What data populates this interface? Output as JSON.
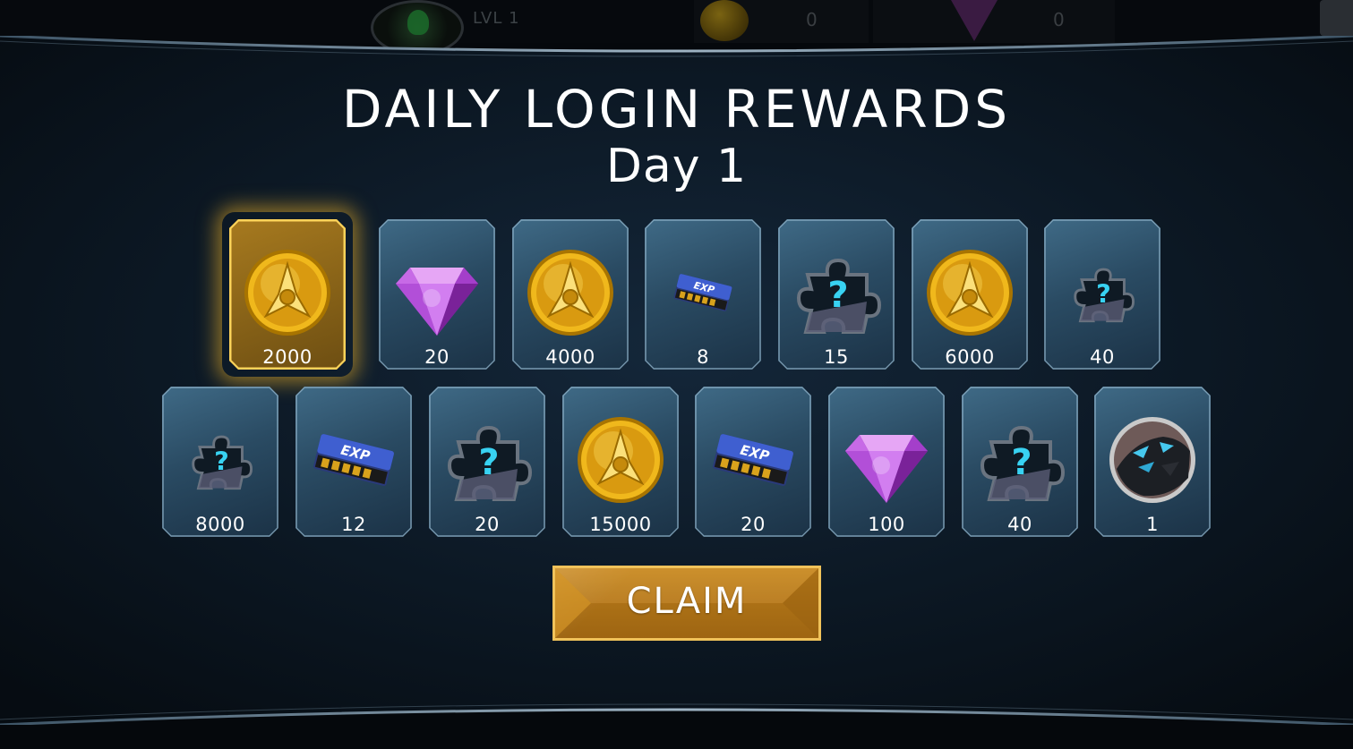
{
  "hud": {
    "level": "LVL 1",
    "coins": "0",
    "gems": "0"
  },
  "dialog": {
    "title": "DAILY LOGIN REWARDS",
    "subtitle": "Day 1",
    "claim_label": "CLAIM"
  },
  "rewards": [
    {
      "amount": "2000",
      "icon": "gold-coin-icon",
      "active": true
    },
    {
      "amount": "20",
      "icon": "purple-gem-icon",
      "active": false
    },
    {
      "amount": "4000",
      "icon": "gold-coin-icon",
      "active": false
    },
    {
      "amount": "8",
      "icon": "exp-card-icon",
      "active": false
    },
    {
      "amount": "15",
      "icon": "mystery-shard-icon",
      "active": false
    },
    {
      "amount": "6000",
      "icon": "gold-coin-icon",
      "active": false
    },
    {
      "amount": "40",
      "icon": "mystery-shard-icon",
      "active": false
    },
    {
      "amount": "8000",
      "icon": "mystery-shard-icon",
      "active": false
    },
    {
      "amount": "12",
      "icon": "exp-card-icon",
      "active": false
    },
    {
      "amount": "20",
      "icon": "mystery-shard-icon",
      "active": false
    },
    {
      "amount": "15000",
      "icon": "gold-coin-icon",
      "active": false
    },
    {
      "amount": "20",
      "icon": "exp-card-icon",
      "active": false
    },
    {
      "amount": "100",
      "icon": "purple-gem-icon",
      "active": false
    },
    {
      "amount": "40",
      "icon": "mystery-shard-icon",
      "active": false
    },
    {
      "amount": "1",
      "icon": "hero-portrait-icon",
      "active": false
    }
  ],
  "colors": {
    "accent_gold": "#c9891f",
    "card_blue": "#2a4b63",
    "gem_purple": "#b84fd6",
    "shard_cyan": "#39d0f0"
  }
}
